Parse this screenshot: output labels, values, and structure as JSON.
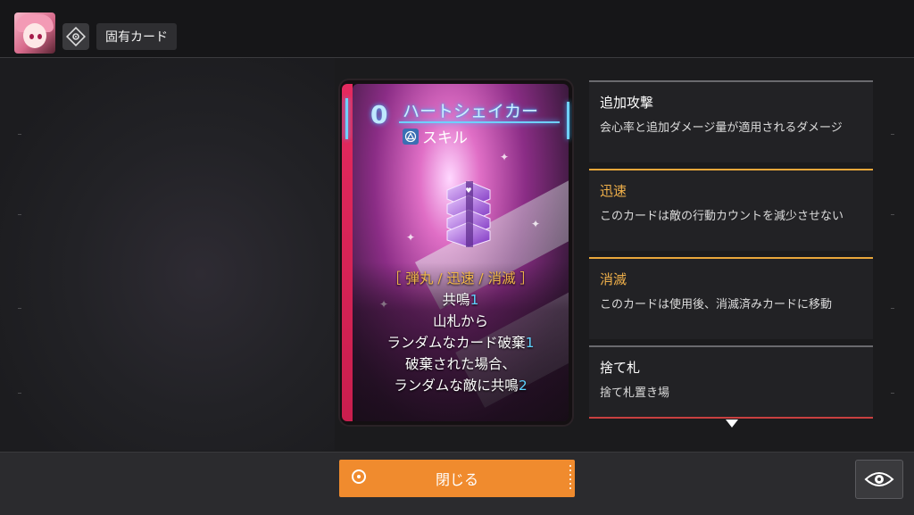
{
  "header": {
    "title": "固有カード"
  },
  "card": {
    "cost": "0",
    "name": "ハートシェイカー",
    "type": "スキル",
    "keywords": "［ 弾丸 / 迅速 / 消滅 ］",
    "line1_text": "共鳴",
    "line1_num": "1",
    "line2": "山札から",
    "line3_text": "ランダムなカード破棄",
    "line3_num": "1",
    "line4": "破棄された場合、",
    "line5_text": "ランダムな敵に共鳴",
    "line5_num": "2"
  },
  "keywords_panel": [
    {
      "title": "追加攻撃",
      "desc": "会心率と追加ダメージ量が適用されるダメージ",
      "accent": "#6a6a6e"
    },
    {
      "title": "迅速",
      "desc": "このカードは敵の行動カウントを減少させない",
      "accent": "#e9a73b"
    },
    {
      "title": "消滅",
      "desc": "このカードは使用後、消滅済みカードに移動",
      "accent": "#e9a73b"
    },
    {
      "title": "捨て札",
      "desc": "捨て札置き場",
      "accent": "#6a6a6e"
    }
  ],
  "footer": {
    "close_label": "閉じる"
  },
  "colors": {
    "accent_orange": "#f08b2e",
    "keyword_gold": "#f2b64a",
    "number_cyan": "#5fd2ff"
  },
  "icons": {
    "avatar": "character-portrait",
    "target": "target-icon",
    "close_circle": "circle-dot-icon",
    "eye": "eye-icon",
    "scroll": "triangle-down-icon"
  }
}
